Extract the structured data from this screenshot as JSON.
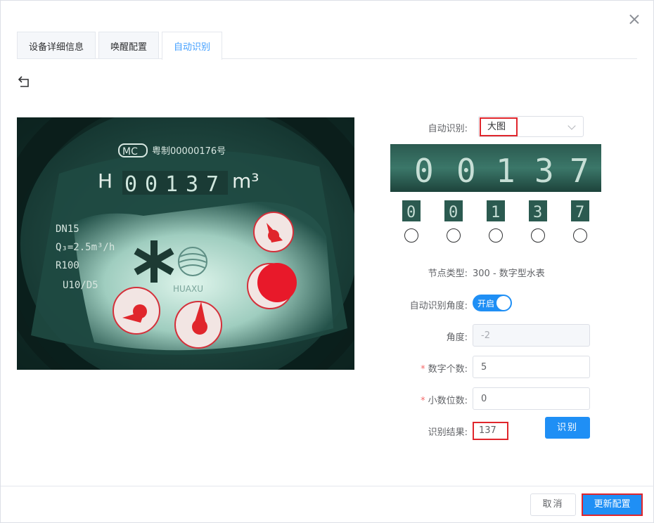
{
  "tabs": [
    {
      "label": "设备详细信息",
      "active": false
    },
    {
      "label": "唤醒配置",
      "active": false
    },
    {
      "label": "自动识别",
      "active": true
    }
  ],
  "meter": {
    "cert_text": "粤制00000176号",
    "reading_prefix": "H",
    "reading_digits": [
      "0",
      "0",
      "1",
      "3",
      "7"
    ],
    "unit": "m³",
    "spec_lines": [
      "DN15",
      "Q₃=2.5m³/h",
      "R100",
      "U10/D5"
    ],
    "brand": "HUAXU"
  },
  "form": {
    "auto_recognize_label": "自动识别:",
    "auto_recognize_value": "大图",
    "recognized_digits": [
      "0",
      "0",
      "1",
      "3",
      "7"
    ],
    "node_type_label": "节点类型:",
    "node_type_value": "300 - 数字型水表",
    "angle_switch_label": "自动识别角度:",
    "angle_switch_text": "开启",
    "angle_label": "角度:",
    "angle_value": "-2",
    "digit_count_label": "数字个数:",
    "digit_count_value": "5",
    "decimal_label": "小数位数:",
    "decimal_value": "0",
    "result_label": "识别结果:",
    "result_value": "137",
    "recognize_button": "识别"
  },
  "footer": {
    "cancel_label": "取消",
    "update_label": "更新配置"
  },
  "colors": {
    "primary": "#1f8ff5",
    "highlight": "#e0262c"
  }
}
